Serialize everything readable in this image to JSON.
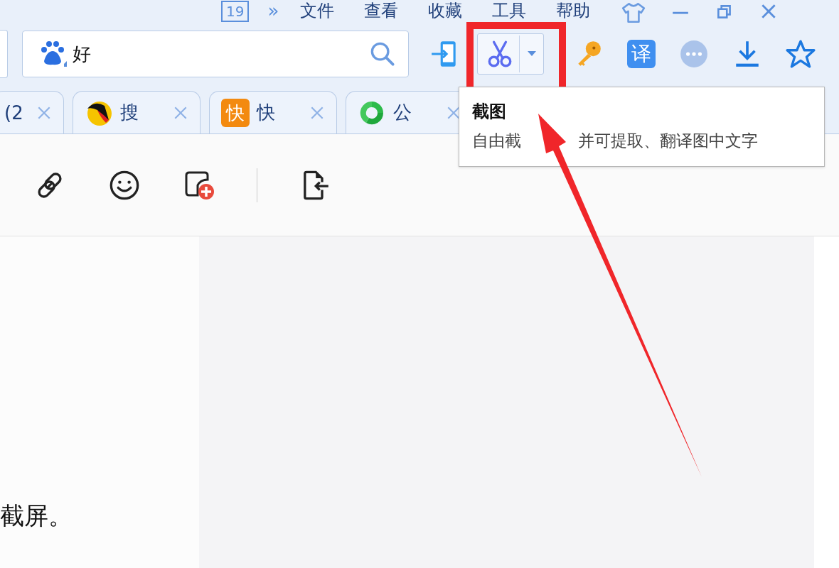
{
  "menu_bar": {
    "tab_count": "19",
    "overflow": "»",
    "items": [
      "文件",
      "查看",
      "收藏",
      "工具",
      "帮助"
    ]
  },
  "search": {
    "value": "好"
  },
  "toolbar": {
    "translate_label": "译"
  },
  "tabs": [
    {
      "kind": "plain",
      "title": "(2"
    },
    {
      "kind": "bird",
      "title": "搜"
    },
    {
      "kind": "quick",
      "title": "快",
      "icon_text": "快"
    },
    {
      "kind": "ring",
      "title": "公"
    }
  ],
  "tooltip": {
    "title": "截图",
    "text_parts": [
      "自由截",
      "并可提取、翻译图中文字"
    ]
  },
  "body": {
    "text": "截屏。"
  },
  "annotation": {
    "highlight_box": true,
    "arrow": true
  }
}
